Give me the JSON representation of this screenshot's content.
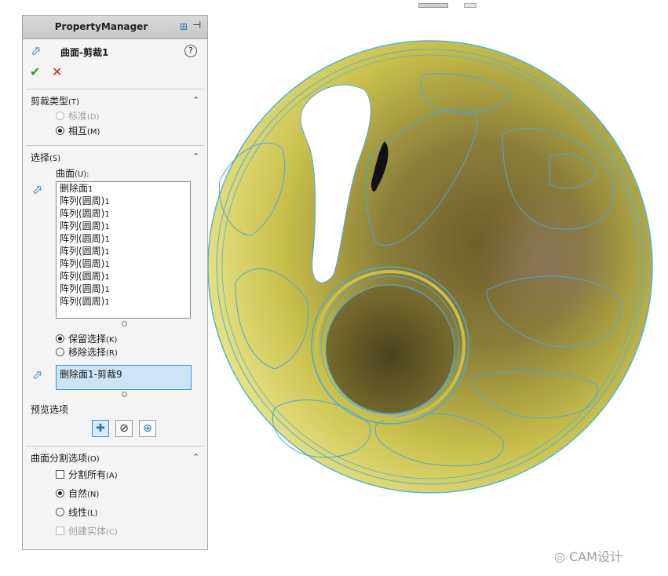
{
  "panel": {
    "manager_title": "PropertyManager",
    "feature_title": "曲面-剪裁1",
    "help": "?"
  },
  "trim_type": {
    "title": "剪裁类型",
    "title_key": "(T)",
    "options": [
      {
        "label": "标准",
        "key": "(D)",
        "selected": false,
        "enabled": false
      },
      {
        "label": "相互",
        "key": "(M)",
        "selected": true,
        "enabled": true
      }
    ]
  },
  "selections": {
    "title": "选择",
    "title_key": "(S)",
    "surfaces_label": "曲面",
    "surfaces_key": "(U):",
    "items": [
      {
        "name": "删除面",
        "num": "1"
      },
      {
        "name": "阵列(圆周)",
        "num": "1"
      },
      {
        "name": "阵列(圆周)",
        "num": "1"
      },
      {
        "name": "阵列(圆周)",
        "num": "1"
      },
      {
        "name": "阵列(圆周)",
        "num": "1"
      },
      {
        "name": "阵列(圆周)",
        "num": "1"
      },
      {
        "name": "阵列(圆周)",
        "num": "1"
      },
      {
        "name": "阵列(圆周)",
        "num": "1"
      },
      {
        "name": "阵列(圆周)",
        "num": "1"
      },
      {
        "name": "阵列(圆周)",
        "num": "1"
      }
    ],
    "keep": {
      "label": "保留选择",
      "key": "(K)",
      "selected": true
    },
    "remove": {
      "label": "移除选择",
      "key": "(R)",
      "selected": false
    },
    "pieces_value": "删除面1-剪裁9"
  },
  "preview": {
    "title": "预览选项"
  },
  "split": {
    "title": "曲面分割选项",
    "title_key": "(O)",
    "split_all": {
      "label": "分割所有",
      "key": "(A)",
      "checked": false
    },
    "natural": {
      "label": "自然",
      "key": "(N)",
      "selected": true
    },
    "linear": {
      "label": "线性",
      "key": "(L)",
      "selected": false
    },
    "create_solid": {
      "label": "创建实体",
      "key": "(C)",
      "checked": false,
      "enabled": false
    }
  },
  "watermark": "CAM设计",
  "colors": {
    "accent": "#2b74c4",
    "ok": "#2e9b2e",
    "cancel": "#d42020",
    "model_base": "#c9c24a",
    "edge": "#5ab4e0"
  }
}
